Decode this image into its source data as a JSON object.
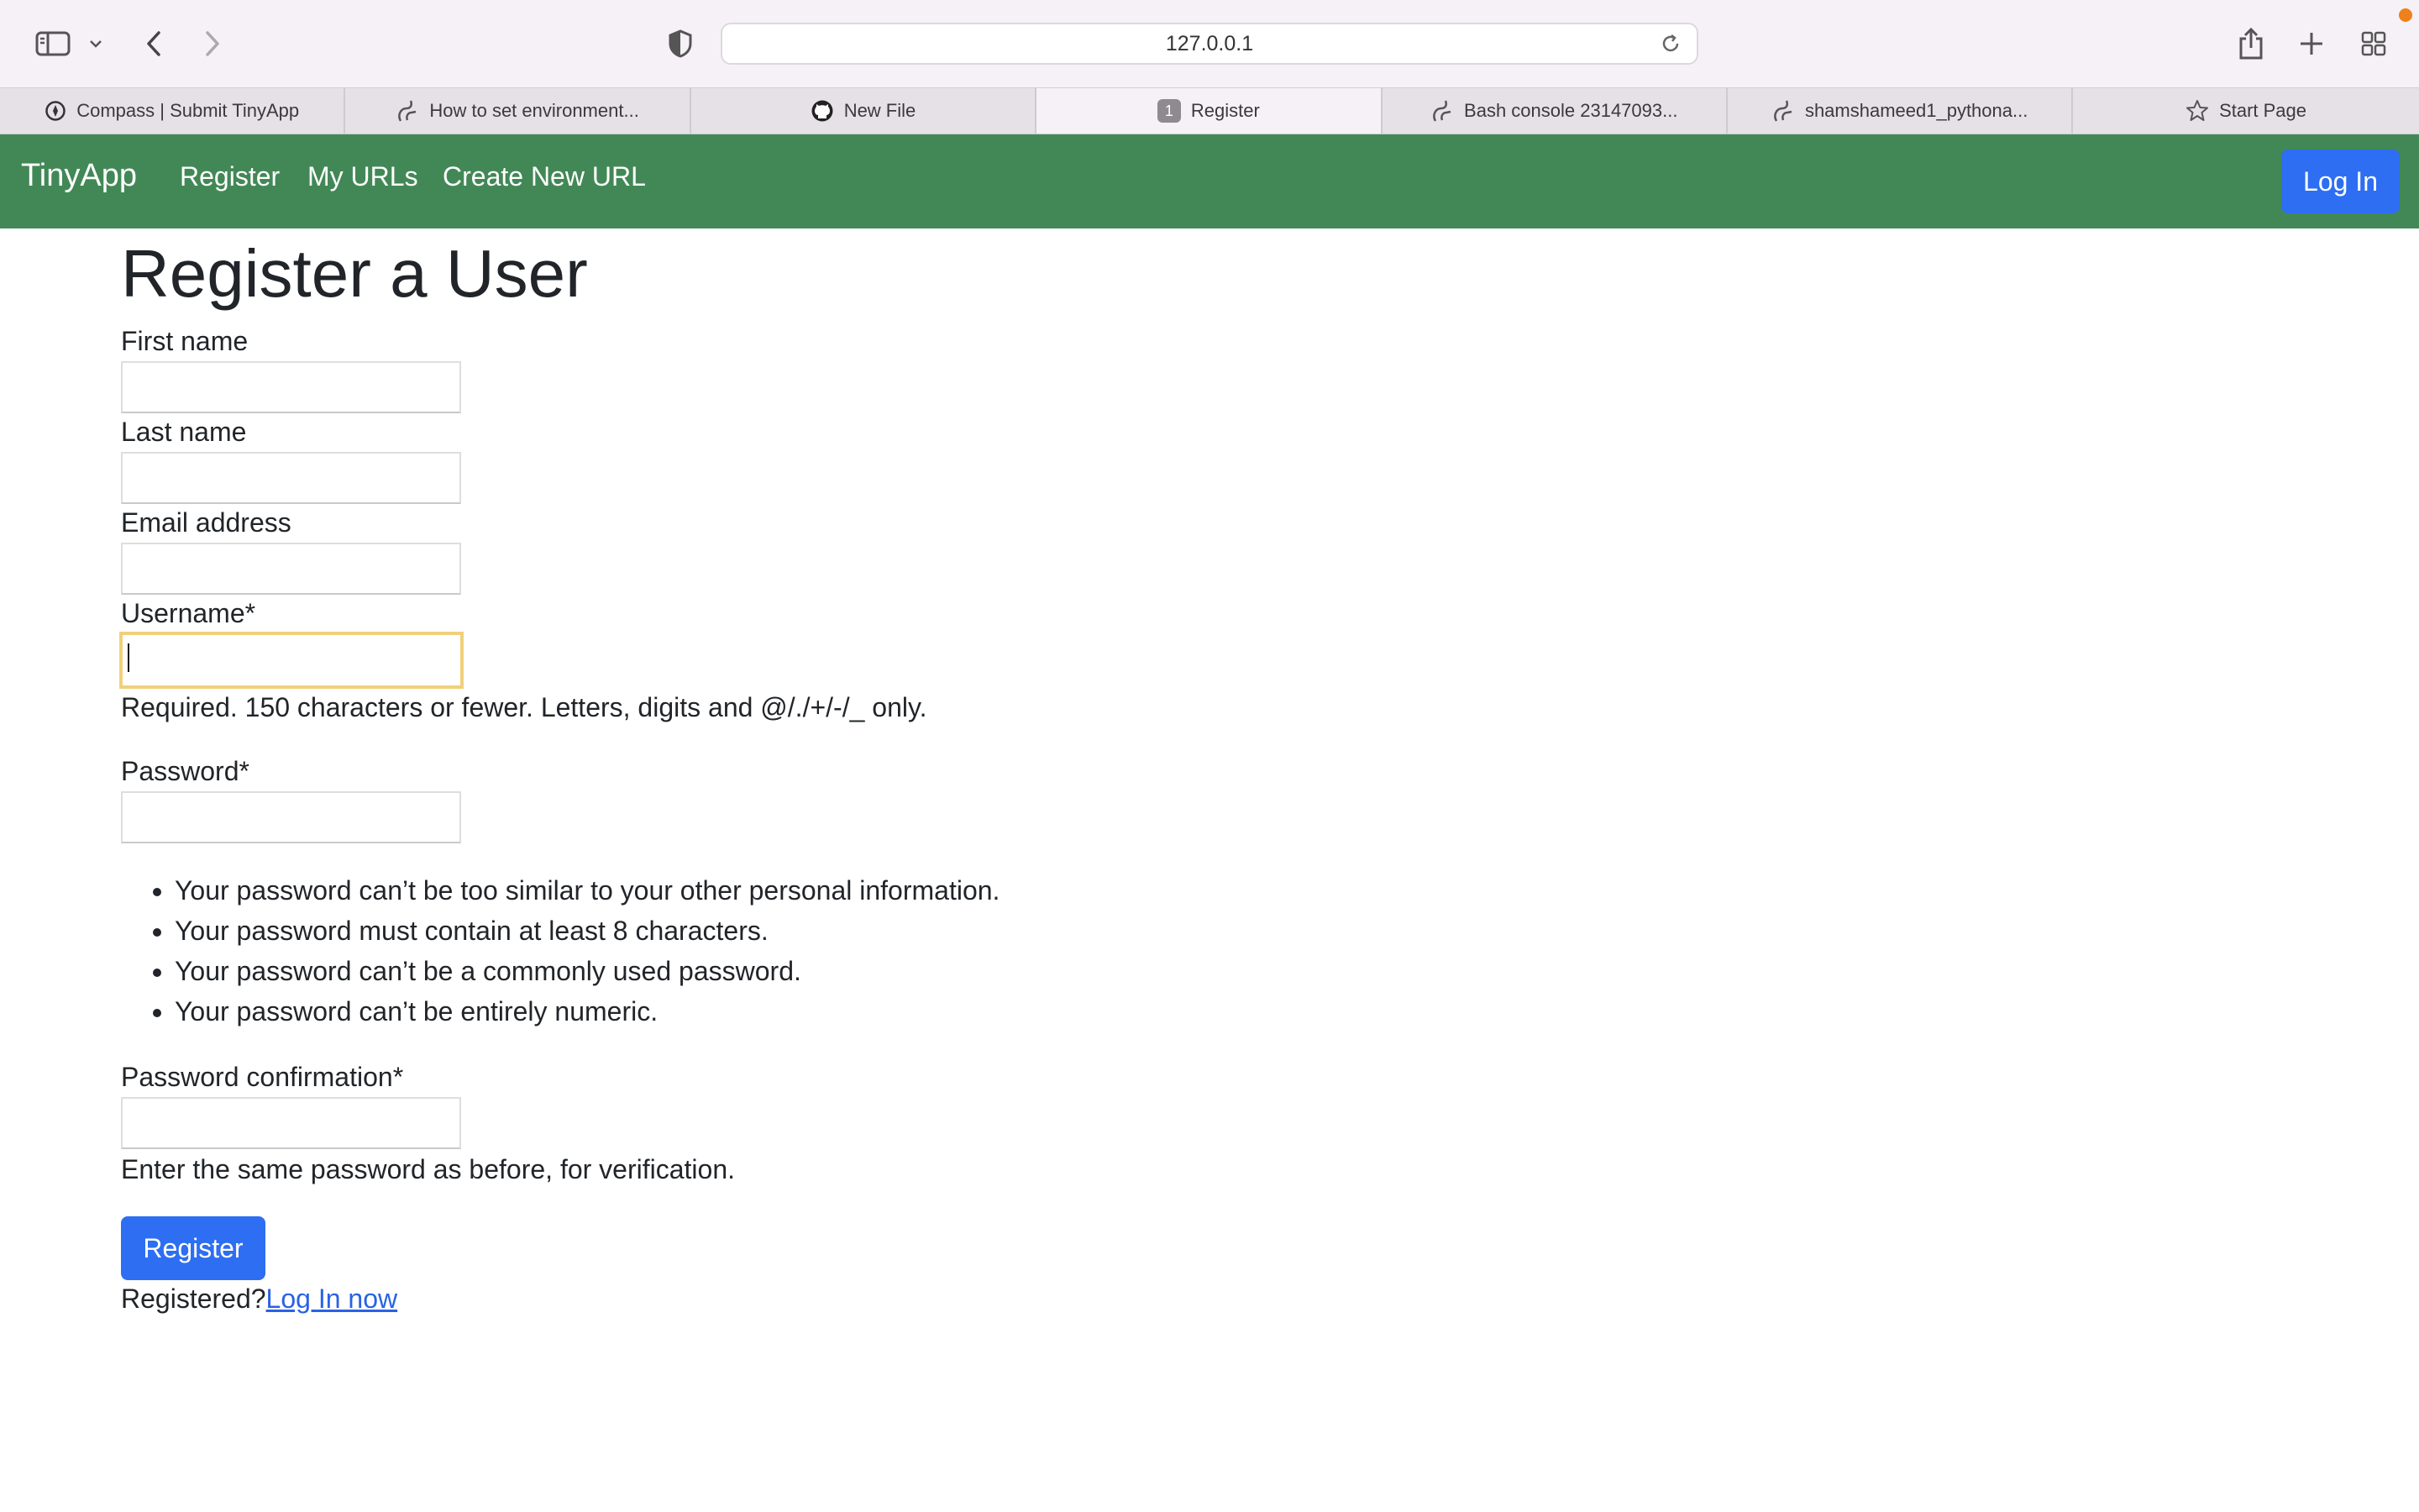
{
  "browser": {
    "url": "127.0.0.1",
    "tabs": [
      {
        "label": "Compass | Submit TinyApp",
        "icon": "compass-icon",
        "active": false
      },
      {
        "label": "How to set environment...",
        "icon": "pythonanywhere-icon",
        "active": false
      },
      {
        "label": "New File",
        "icon": "github-icon",
        "active": false
      },
      {
        "label": "Register",
        "icon": "number-badge-icon",
        "badge": "1",
        "active": true
      },
      {
        "label": "Bash console 23147093...",
        "icon": "pythonanywhere-icon",
        "active": false
      },
      {
        "label": "shamshameed1_pythona...",
        "icon": "pythonanywhere-icon",
        "active": false
      },
      {
        "label": "Start Page",
        "icon": "star-icon",
        "active": false
      }
    ],
    "notification_color": "#f0801b"
  },
  "navbar": {
    "brand": "TinyApp",
    "links": [
      "Register",
      "My URLs",
      "Create New URL"
    ],
    "login_label": "Log In",
    "background": "#428856",
    "button_color": "#2d6ef2"
  },
  "form": {
    "title": "Register a User",
    "first_name_label": "First name",
    "first_name_value": "",
    "last_name_label": "Last name",
    "last_name_value": "",
    "email_label": "Email address",
    "email_value": "",
    "username_label": "Username*",
    "username_value": "",
    "username_help": "Required. 150 characters or fewer. Letters, digits and @/./+/-/_ only.",
    "password_label": "Password*",
    "password_value": "",
    "password_rules": [
      "Your password can’t be too similar to your other personal information.",
      "Your password must contain at least 8 characters.",
      "Your password can’t be a commonly used password.",
      "Your password can’t be entirely numeric."
    ],
    "password_confirm_label": "Password confirmation*",
    "password_confirm_value": "",
    "password_confirm_help": "Enter the same password as before, for verification.",
    "submit_label": "Register",
    "footer_text": "Registered?",
    "footer_link": "Log In now"
  }
}
